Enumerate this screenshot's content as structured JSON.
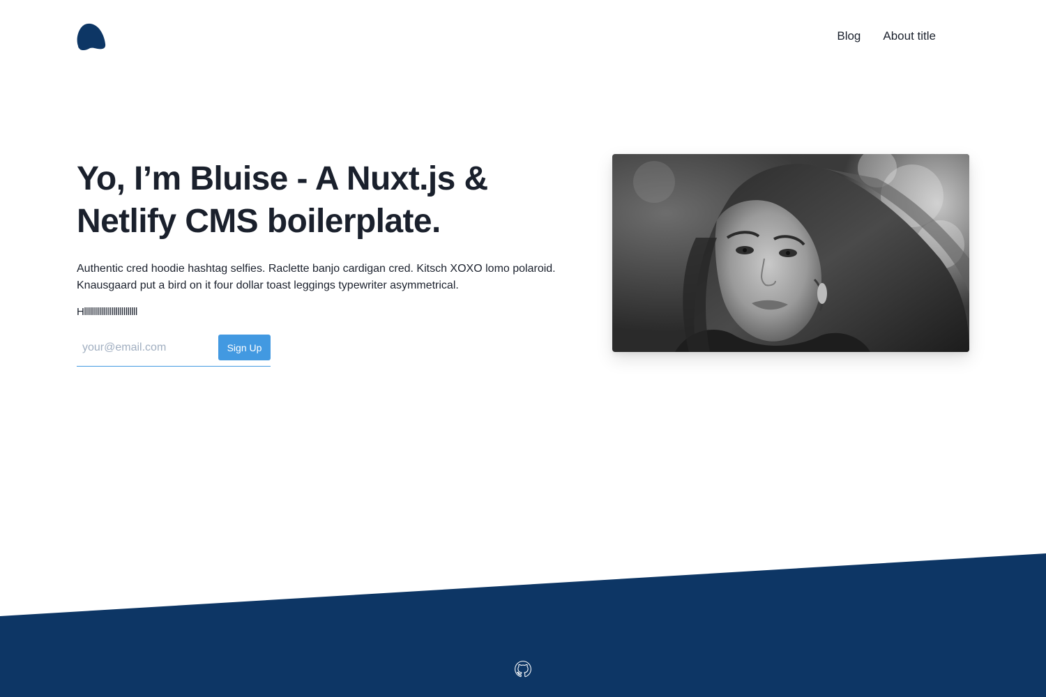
{
  "header": {
    "logo_icon": "blob-logo-icon",
    "nav": [
      {
        "label": "Blog"
      },
      {
        "label": "About title"
      }
    ]
  },
  "hero": {
    "title": "Yo, I’m Bluise - A Nuxt.js & Netlify CMS boilerplate.",
    "description": "Authentic cred hoodie hashtag selfies. Raclette banjo cardigan cred. Kitsch XOXO lomo polaroid. Knausgaard put a bird on it four dollar toast leggings typewriter asymmetrical.",
    "extra_text": "Hlllllllllllllllllllllllllll",
    "signup": {
      "email_placeholder": "your@email.com",
      "email_value": "",
      "button_label": "Sign Up"
    },
    "image_icon": "portrait-photo"
  },
  "footer": {
    "icon": "github-icon"
  },
  "colors": {
    "brand_navy": "#0d3665",
    "accent_blue": "#4299e1",
    "text": "#1a202c"
  }
}
